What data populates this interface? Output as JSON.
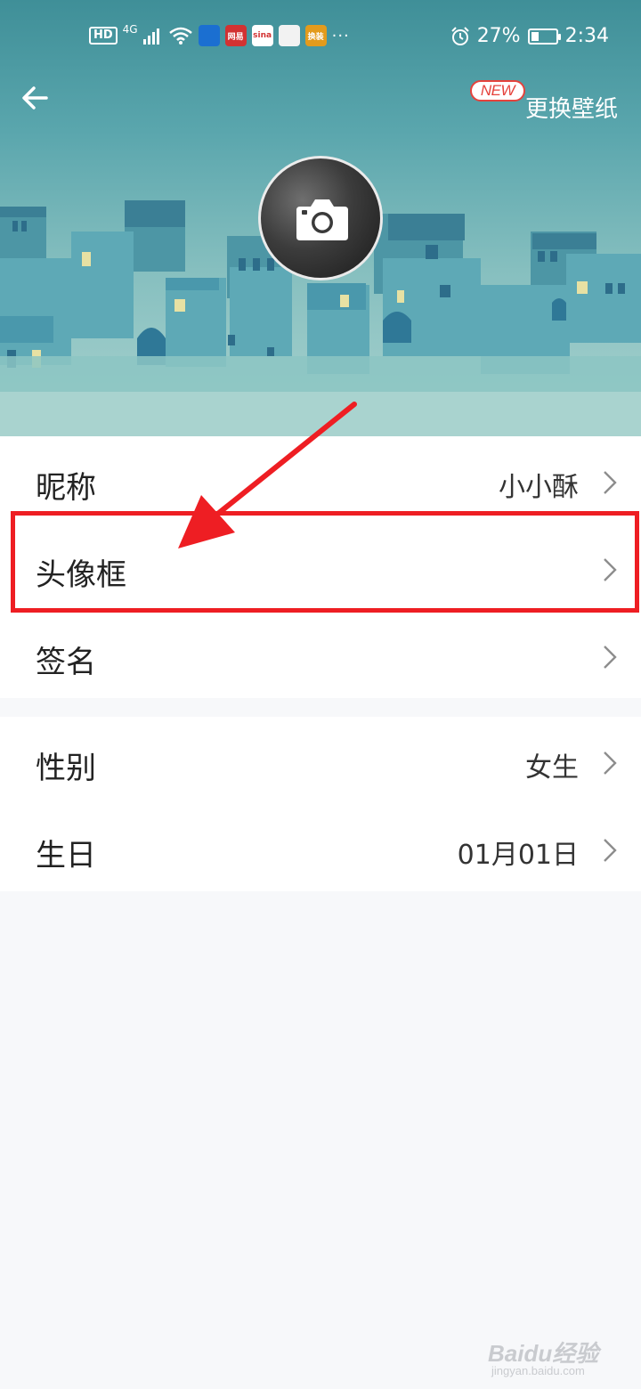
{
  "status_bar": {
    "hd": "HD",
    "network": "4G",
    "apps": [
      {
        "name": "shield-app-icon",
        "color": "#1b6fd1",
        "label": ""
      },
      {
        "name": "netease-app-icon",
        "color": "#d23232",
        "label": "网易"
      },
      {
        "name": "sina-app-icon",
        "color": "#ffffff",
        "label": "sina"
      },
      {
        "name": "map-app-icon",
        "color": "#f2f2f2",
        "label": ""
      },
      {
        "name": "huanle-app-icon",
        "color": "#e39b1c",
        "label": "换装"
      }
    ],
    "more": "···",
    "battery": "27%",
    "battery_level": 0.27,
    "time": "2:34"
  },
  "header": {
    "new_badge": "NEW",
    "change_wallpaper": "更换壁纸"
  },
  "profile_items": [
    {
      "label": "昵称",
      "value": "小小酥"
    },
    {
      "label": "头像框",
      "value": ""
    },
    {
      "label": "签名",
      "value": ""
    }
  ],
  "info_items": [
    {
      "label": "性别",
      "value": "女生"
    },
    {
      "label": "生日",
      "value": "01月01日"
    }
  ],
  "watermark": {
    "brand": "Baidu经验",
    "url": "jingyan.baidu.com"
  },
  "colors": {
    "highlight": "#ee1e23",
    "sky_top": "#3f8f98",
    "sky_bottom": "#a9d3cf"
  }
}
